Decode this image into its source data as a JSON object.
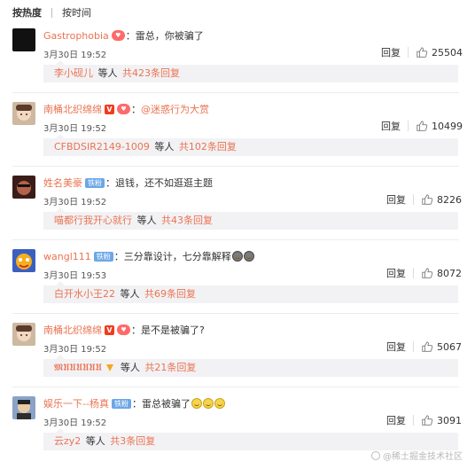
{
  "sort": {
    "hot": "按热度",
    "time": "按时间"
  },
  "colors": {
    "username": "#eb7350",
    "badge_vip": "#f03c1e",
    "badge_fans": "#ff6a6a",
    "badge_tieba": "#6ba7e6",
    "reply_bg": "#f2f2f5"
  },
  "reply_label": "回复",
  "icons": {
    "like": "thumbs-up-icon"
  },
  "comments": [
    {
      "user": "Gastrophobia",
      "colon": "：",
      "text": "雷总，你被骗了",
      "date": "3月30日 19:52",
      "likes": "25504",
      "replies": {
        "user": "李小砚儿",
        "mid": "等人",
        "total": "共423条回复"
      }
    },
    {
      "user": "南桶北织绵绵",
      "colon": "：",
      "mention": "@迷惑行为大赏",
      "date": "3月30日 19:52",
      "likes": "10499",
      "replies": {
        "user": "CFBDSIR2149-1009",
        "mid": "等人",
        "total": "共102条回复"
      }
    },
    {
      "user": "姓名美豪",
      "badge": "铁粉",
      "colon": "：",
      "text": "退钱，还不如逛逛主题",
      "date": "3月30日 19:52",
      "likes": "8226",
      "replies": {
        "user": "喵都行我开心就行",
        "mid": "等人",
        "total": "共43条回复"
      }
    },
    {
      "user": "wangl111",
      "badge": "铁粉",
      "colon": "：",
      "text": "三分靠设计，七分靠解释",
      "date": "3月30日 19:53",
      "likes": "8072",
      "replies": {
        "user": "白开水小王22",
        "mid": "等人",
        "total": "共69条回复"
      }
    },
    {
      "user": "南桶北织绵绵",
      "colon": "：",
      "text": "是不是被骗了?",
      "date": "3月30日 19:52",
      "likes": "5067",
      "replies": {
        "user": "𝕸𝖀𝖀𝖀𝖀𝖀𝖀",
        "mid": "等人",
        "total": "共21条回复"
      }
    },
    {
      "user": "娱乐一下--杨真",
      "badge": "铁粉",
      "colon": "：",
      "text": "雷总被骗了",
      "date": "3月30日 19:52",
      "likes": "3091",
      "replies": {
        "user": "云zy2",
        "mid": "等人",
        "total": "共3条回复"
      }
    }
  ],
  "watermark": "@稀土掘金技术社区"
}
